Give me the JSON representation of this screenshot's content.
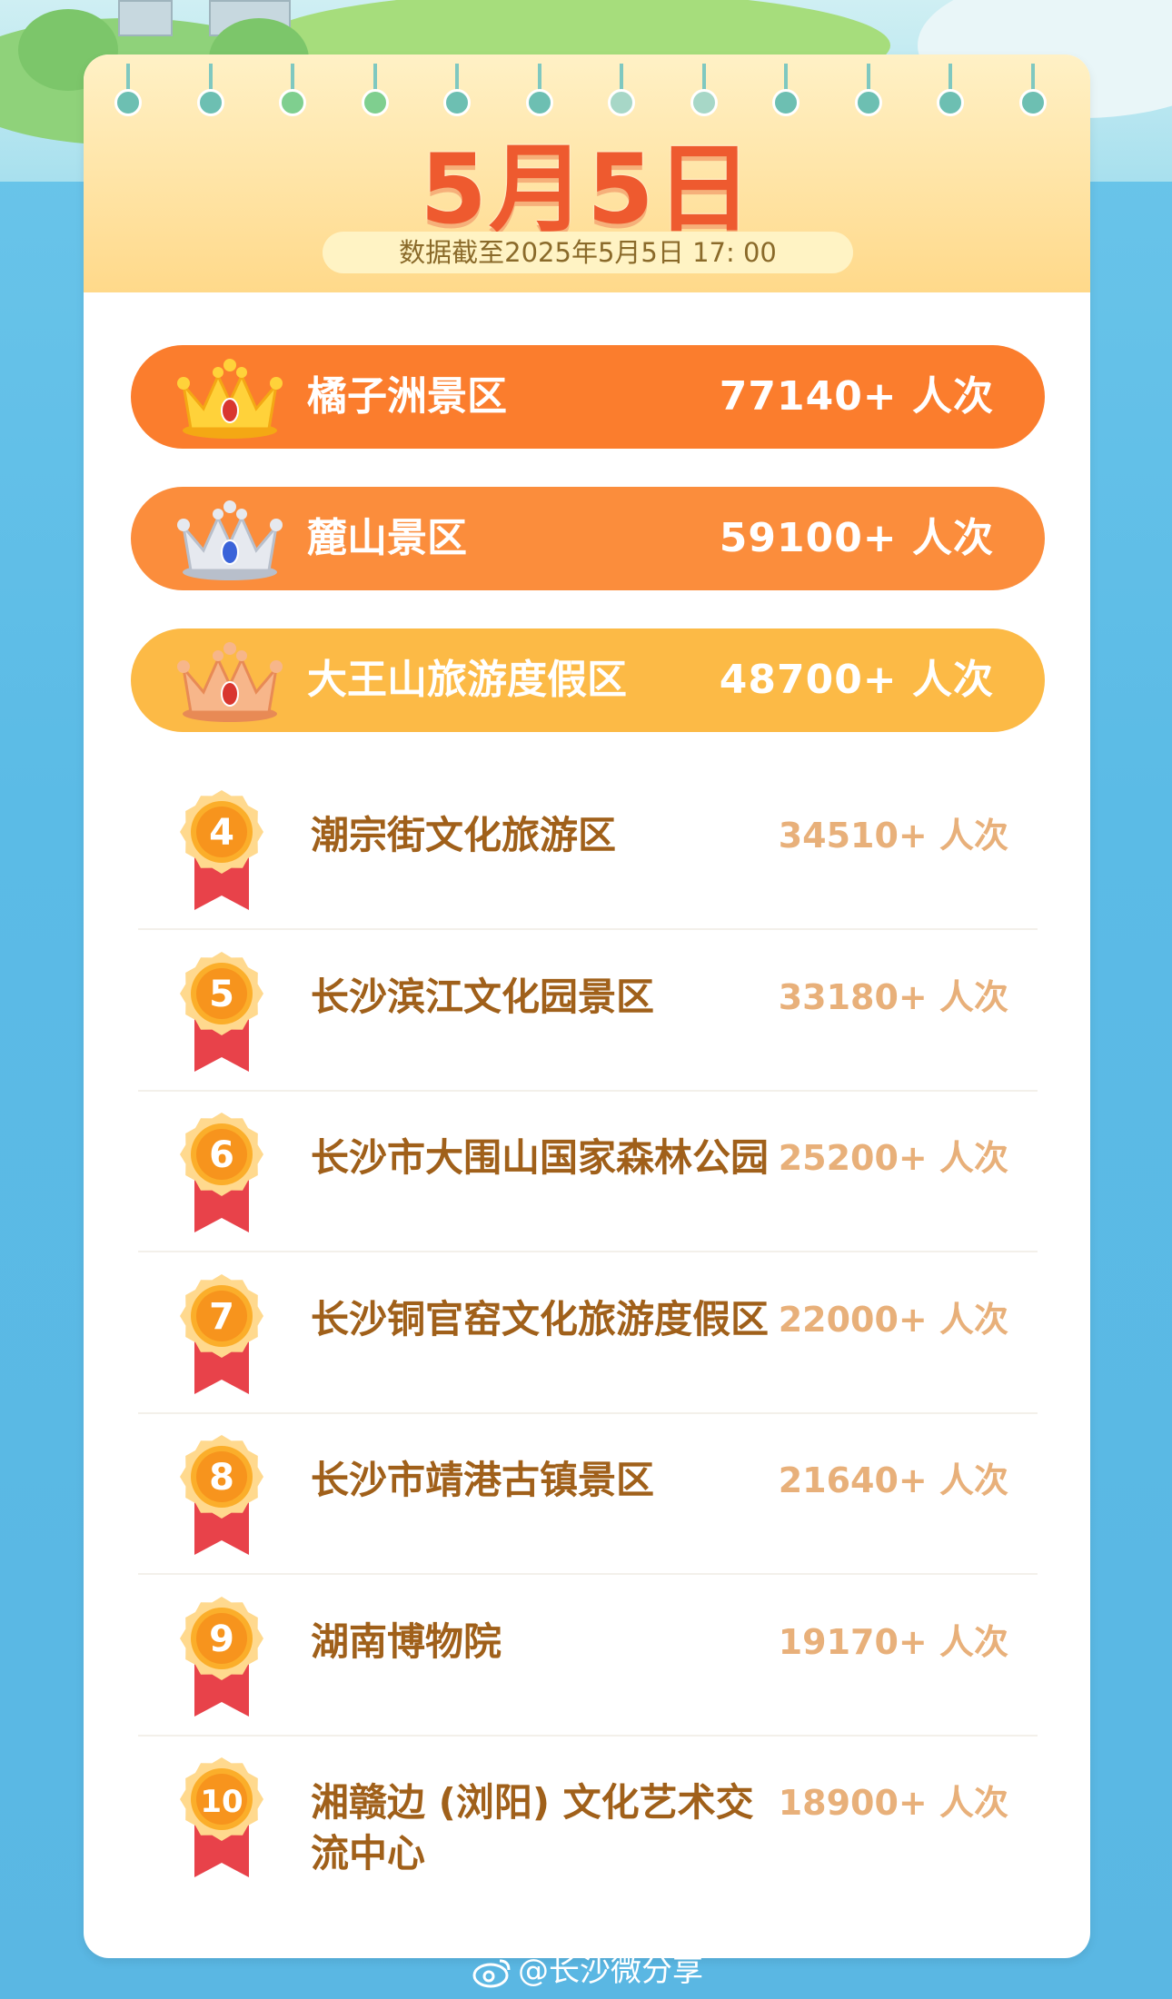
{
  "header": {
    "date_title": "5月5日",
    "cutoff_text": "数据截至2025年5月5日 17: 00"
  },
  "top3": [
    {
      "rank": 1,
      "name": "橘子洲景区",
      "count": "77140+ 人次",
      "crown": "gold-crown-icon",
      "color": "#fb7d2d"
    },
    {
      "rank": 2,
      "name": "麓山景区",
      "count": "59100+ 人次",
      "crown": "silver-crown-icon",
      "color": "#fb8d3c"
    },
    {
      "rank": 3,
      "name": "大王山旅游度假区",
      "count": "48700+ 人次",
      "crown": "bronze-crown-icon",
      "color": "#fcba46"
    }
  ],
  "ranking": [
    {
      "rank": "4",
      "name": "潮宗街文化旅游区",
      "count": "34510+ 人次"
    },
    {
      "rank": "5",
      "name": "长沙滨江文化园景区",
      "count": "33180+ 人次"
    },
    {
      "rank": "6",
      "name": "长沙市大围山国家森林公园",
      "count": "25200+ 人次"
    },
    {
      "rank": "7",
      "name": "长沙铜官窑文化旅游度假区",
      "count": "22000+ 人次"
    },
    {
      "rank": "8",
      "name": "长沙市靖港古镇景区",
      "count": "21640+ 人次"
    },
    {
      "rank": "9",
      "name": "湖南博物院",
      "count": "19170+ 人次"
    },
    {
      "rank": "10",
      "name": "湘赣边 (浏阳) 文化艺术交流中心",
      "count": "18900+ 人次"
    }
  ],
  "watermark": {
    "text": "@长沙微分享",
    "icon": "weibo-icon"
  }
}
